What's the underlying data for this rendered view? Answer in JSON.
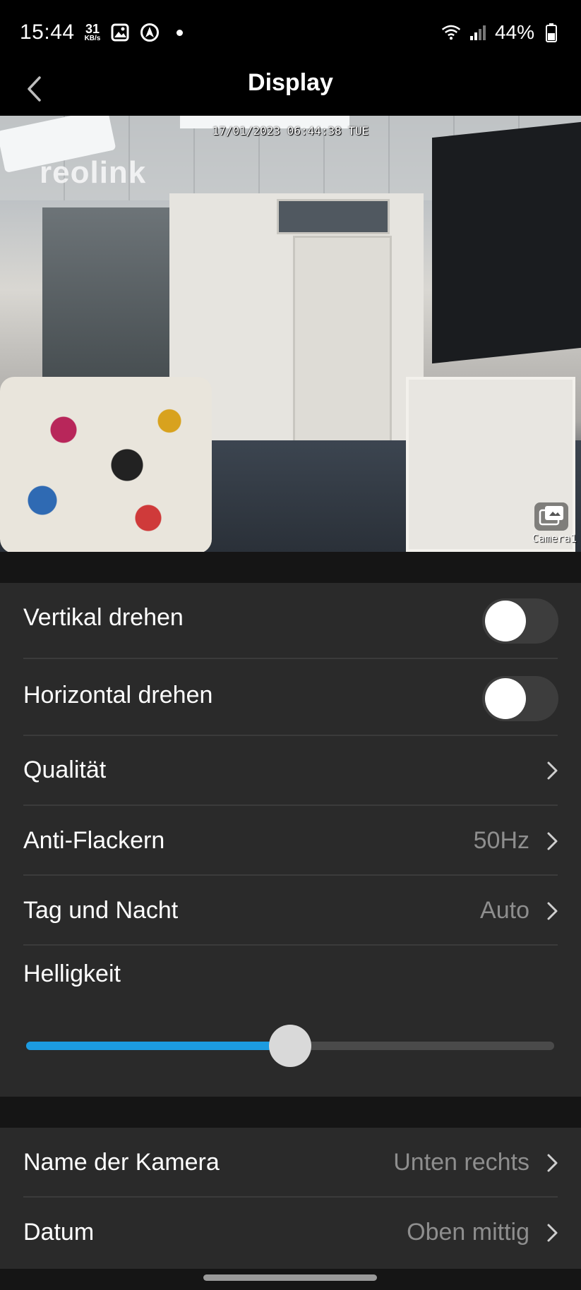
{
  "status_bar": {
    "time": "15:44",
    "speed_value": "31",
    "speed_unit": "KB/s",
    "battery": "44%",
    "icons": [
      "gallery-icon",
      "location-icon",
      "notification-dot",
      "wifi-icon",
      "signal-icon",
      "battery-icon"
    ]
  },
  "app_bar": {
    "title": "Display",
    "back_icon": "chevron-left-icon"
  },
  "camera": {
    "timestamp": "17/01/2023 06:44:38 TUE",
    "logo": "reolink",
    "name_overlay": "Camera1",
    "switch_icon": "camera-switch-icon"
  },
  "settings": {
    "vertical_flip": {
      "label": "Vertikal drehen",
      "on": false
    },
    "horizontal_flip": {
      "label": "Horizontal drehen",
      "on": false
    },
    "quality": {
      "label": "Qualität"
    },
    "anti_flicker": {
      "label": "Anti-Flackern",
      "value": "50Hz"
    },
    "day_night": {
      "label": "Tag und Nacht",
      "value": "Auto"
    },
    "brightness": {
      "label": "Helligkeit",
      "level": 0.5
    },
    "camera_name": {
      "label": "Name der Kamera",
      "value": "Unten rechts"
    },
    "date": {
      "label": "Datum",
      "value": "Oben mittig"
    }
  },
  "colors": {
    "accent": "#1c9be0",
    "background": "#151515",
    "panel": "#2a2a2a",
    "secondary_text": "#8e8e8e"
  }
}
